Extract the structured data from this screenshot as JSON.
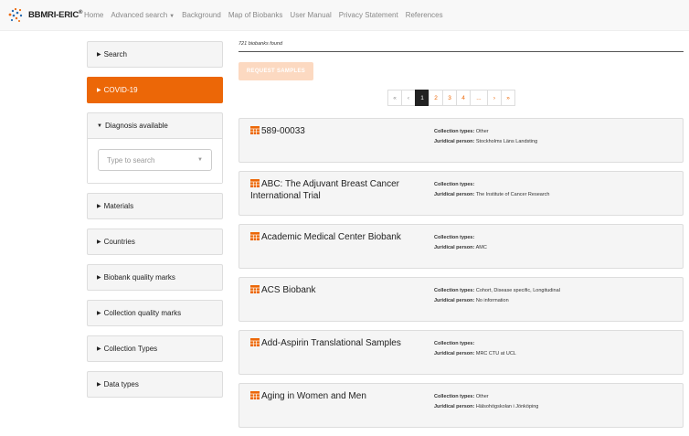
{
  "navbar": {
    "brand": "BBMRI-ERIC",
    "brand_mark": "®",
    "links": [
      "Home",
      "Advanced search",
      "Background",
      "Map of Biobanks",
      "User Manual",
      "Privacy Statement",
      "References"
    ]
  },
  "sidebar": {
    "facets": [
      {
        "label": "Search"
      },
      {
        "label": "COVID-19"
      },
      {
        "label": "Diagnosis available"
      },
      {
        "label": "Materials"
      },
      {
        "label": "Countries"
      },
      {
        "label": "Biobank quality marks"
      },
      {
        "label": "Collection quality marks"
      },
      {
        "label": "Collection Types"
      },
      {
        "label": "Data types"
      }
    ],
    "diagnosis_placeholder": "Type to search"
  },
  "main": {
    "results_count": "721 biobanks found",
    "request_button": "REQUEST SAMPLES",
    "pagination": [
      "«",
      "‹",
      "1",
      "2",
      "3",
      "4",
      "...",
      "›",
      "»"
    ],
    "collection_types_label": "Collection types:",
    "juridical_label": "Juridical person:",
    "cards": [
      {
        "title": "589-00033",
        "collection_types": "Other",
        "juridical": "Stockholms Läns Landsting"
      },
      {
        "title": "ABC: The Adjuvant Breast Cancer International Trial",
        "collection_types": "",
        "juridical": "The Institute of Cancer Research"
      },
      {
        "title": "Academic Medical Center Biobank",
        "collection_types": "",
        "juridical": "AMC"
      },
      {
        "title": "ACS Biobank",
        "collection_types": "Cohort, Disease specific, Longitudinal",
        "juridical": "No information"
      },
      {
        "title": "Add-Aspirin Translational Samples",
        "collection_types": "",
        "juridical": "MRC CTU at UCL"
      },
      {
        "title": "Aging in Women and Men",
        "collection_types": "Other",
        "juridical": "Hälsohögskolan i Jönköping"
      }
    ]
  },
  "colors": {
    "accent": "#ec6707",
    "accent_light": "#fcd9c1"
  }
}
